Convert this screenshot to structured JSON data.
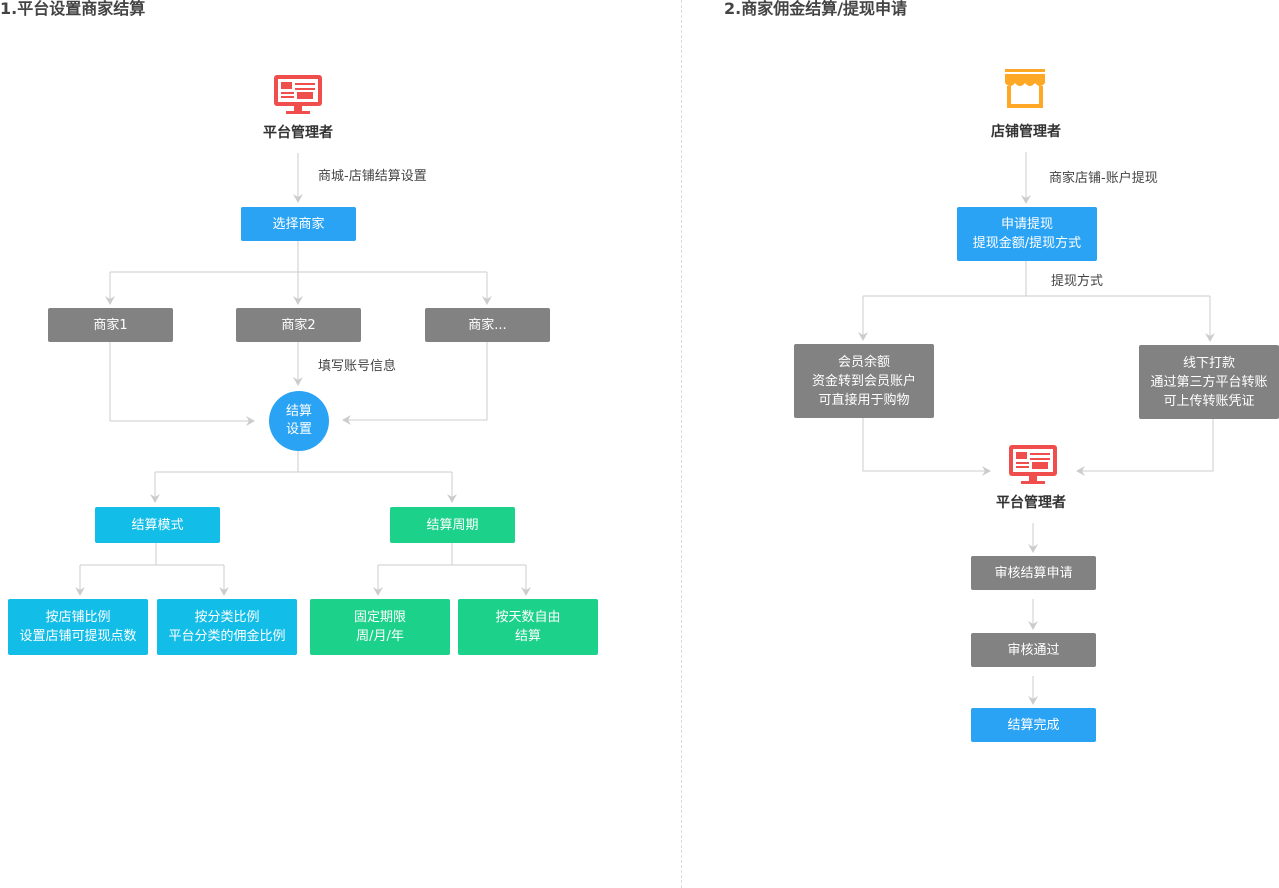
{
  "left": {
    "title": "1.平台设置商家结算",
    "role": "平台管理者",
    "edge_setup": "商城-店铺结算设置",
    "select_merchant": "选择商家",
    "merchants": [
      "商家1",
      "商家2",
      "商家..."
    ],
    "edge_fill": "填写账号信息",
    "settle_setting": [
      "结算",
      "设置"
    ],
    "mode": "结算模式",
    "period": "结算周期",
    "mode_options": [
      [
        "按店铺比例",
        "设置店铺可提现点数"
      ],
      [
        "按分类比例",
        "平台分类的佣金比例"
      ]
    ],
    "period_options": [
      [
        "固定期限",
        "周/月/年"
      ],
      [
        "按天数自由",
        "结算"
      ]
    ]
  },
  "right": {
    "title": "2.商家佣金结算/提现申请",
    "role_store": "店铺管理者",
    "edge_withdraw": "商家店铺-账户提现",
    "apply": [
      "申请提现",
      "提现金额/提现方式"
    ],
    "edge_method": "提现方式",
    "methods": [
      [
        "会员余额",
        "资金转到会员账户",
        "可直接用于购物"
      ],
      [
        "线下打款",
        "通过第三方平台转账",
        "可上传转账凭证"
      ]
    ],
    "role_platform": "平台管理者",
    "steps": [
      "审核结算申请",
      "审核通过",
      "结算完成"
    ]
  },
  "colors": {
    "blue": "#2aa3f5",
    "gray": "#828282",
    "cyan": "#12bde8",
    "green": "#1cd28a",
    "icon_red": "#f04d4d",
    "icon_orange": "#ffa826",
    "connector": "#cccccc"
  },
  "icons": {
    "platform": "monitor-icon",
    "store": "storefront-icon"
  }
}
